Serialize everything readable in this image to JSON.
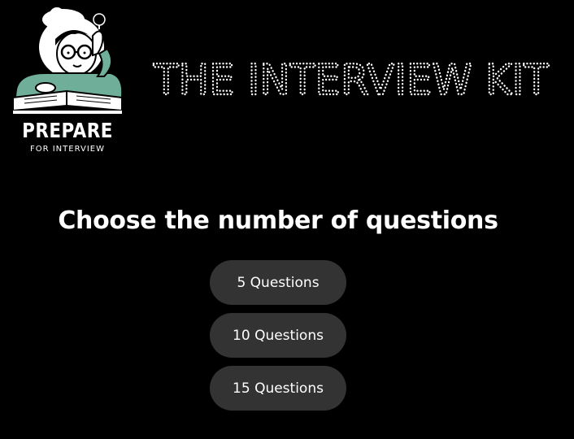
{
  "logo": {
    "title": "PREPARE",
    "subtitle": "FOR INTERVIEW",
    "accent_color": "#6fae98"
  },
  "banner": {
    "title": "THE INTERVIEW KIT"
  },
  "main": {
    "heading": "Choose the number of questions",
    "options": [
      {
        "label": "5 Questions"
      },
      {
        "label": "10 Questions"
      },
      {
        "label": "15 Questions"
      }
    ]
  },
  "colors": {
    "background": "#000000",
    "button": "#333333",
    "text": "#ffffff"
  }
}
